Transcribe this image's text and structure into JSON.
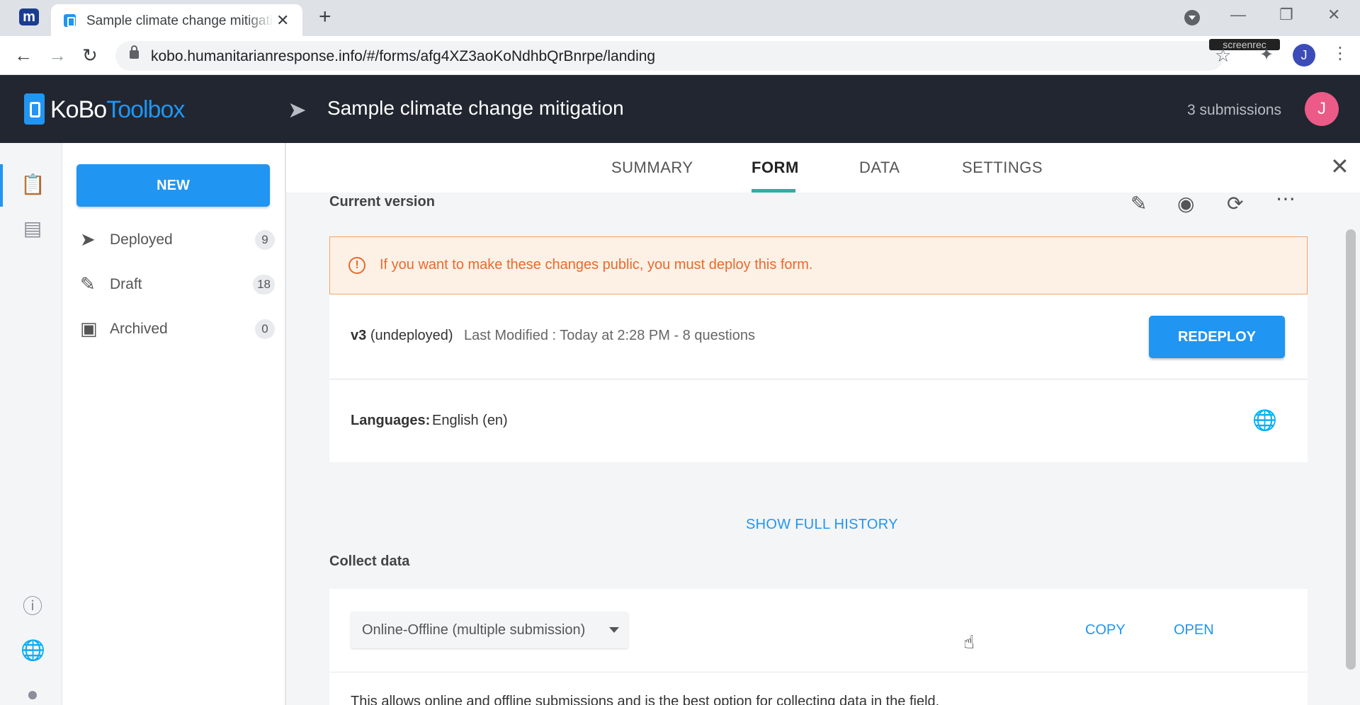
{
  "browser": {
    "tab_title": "Sample climate change mitigation",
    "tab_close": "✕",
    "new_tab": "+",
    "url": "kobo.humanitarianresponse.info/#/forms/afg4XZ3aoKoNdhbQrBnrpe/landing",
    "profile_initial": "J",
    "screenrec_badge": "screenrec",
    "ext_icon": "m",
    "icons": {
      "back": "back-arrow-icon",
      "forward": "forward-arrow-icon",
      "reload": "reload-icon",
      "star": "star-icon",
      "extensions": "puzzle-icon",
      "menu": "kebab-icon"
    }
  },
  "header": {
    "logo_part1": "KoBo",
    "logo_part2": "Toolbox",
    "form_title": "Sample climate change mitigation",
    "submissions": "3 submissions",
    "avatar_initial": "J",
    "colors": {
      "background": "#212630",
      "brand": "#2095f2",
      "avatar": "#ec5a87"
    }
  },
  "sidebar": {
    "new_label": "NEW",
    "items": [
      {
        "label": "Deployed",
        "count": "9",
        "icon": "rocket-icon"
      },
      {
        "label": "Draft",
        "count": "18",
        "icon": "draft-icon"
      },
      {
        "label": "Archived",
        "count": "0",
        "icon": "archive-icon"
      }
    ]
  },
  "rail": {
    "icons": [
      "forms-icon",
      "library-icon",
      "help-icon",
      "globe-icon",
      "github-icon"
    ]
  },
  "main": {
    "tabs": [
      {
        "label": "SUMMARY",
        "active": false
      },
      {
        "label": "FORM",
        "active": true
      },
      {
        "label": "DATA",
        "active": false
      },
      {
        "label": "SETTINGS",
        "active": false
      }
    ],
    "current_version_title": "Current version",
    "actions": [
      "edit-pencil-icon",
      "preview-eye-icon",
      "replace-refresh-icon",
      "more-icon"
    ],
    "alert": {
      "text": "If you want to make these changes public, you must deploy this form.",
      "color": "#e9692c"
    },
    "version": {
      "label": "v3",
      "status": "(undeployed)",
      "meta": "Last Modified : Today at 2:28 PM - 8 questions",
      "redeploy_label": "REDEPLOY"
    },
    "languages": {
      "label": "Languages:",
      "value": "English (en)"
    },
    "show_history_label": "SHOW FULL HISTORY",
    "collect": {
      "title": "Collect data",
      "selected_method": "Online-Offline (multiple submission)",
      "copy_label": "COPY",
      "open_label": "OPEN",
      "description": "This allows online and offline submissions and is the best option for collecting data in the field."
    }
  }
}
